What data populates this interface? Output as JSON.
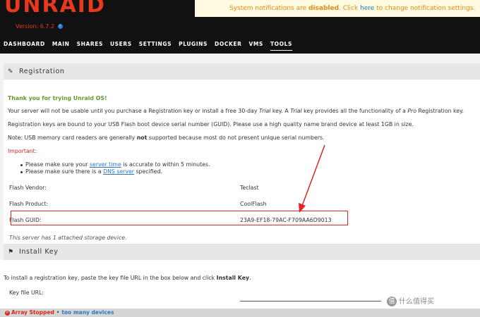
{
  "header": {
    "logo_text": "UNRAID",
    "version": "Version: 6.7.2",
    "info_icon": "info-icon",
    "notification": {
      "prefix": "System notifications are ",
      "state": "disabled",
      "middle": ". Click ",
      "link": "here",
      "suffix": " to change notification settings."
    }
  },
  "nav": {
    "items": [
      "DASHBOARD",
      "MAIN",
      "SHARES",
      "USERS",
      "SETTINGS",
      "PLUGINS",
      "DOCKER",
      "VMS",
      "TOOLS"
    ],
    "active": "TOOLS"
  },
  "registration": {
    "title": "Registration",
    "icon": "pencil-icon",
    "thanks": "Thank you for trying Unraid OS!",
    "line1_a": "Your server will not be usable until you purchase a Registration key or install a free 30-day ",
    "line1_trial": "Trial",
    "line1_b": " key. A ",
    "line1_trial2": "Trial",
    "line1_c": " key provides all the functionality of a ",
    "line1_pro": "Pro",
    "line1_d": " Registration key.",
    "line2": "Registration keys are bound to your USB Flash boot device serial number (GUID). Please use a high quality name brand device at least 1GB in size.",
    "line3_a": "Note: USB memory card readers are generally ",
    "line3_not": "not",
    "line3_b": " supported because most do not present unique serial numbers.",
    "important": "Important:",
    "bullet1_a": "Please make sure your ",
    "bullet1_link": "server time",
    "bullet1_b": " is accurate to within 5 minutes.",
    "bullet2_a": "Please make sure there is a ",
    "bullet2_link": "DNS server",
    "bullet2_b": " specified.",
    "fields": [
      {
        "label": "Flash Vendor:",
        "value": "Teclast"
      },
      {
        "label": "Flash Product:",
        "value": "CoolFlash"
      },
      {
        "label": "Flash GUID:",
        "value": "23A9-EF18-79AC-F709AA6D9013"
      }
    ],
    "storage_note": "This server has 1 attached storage device."
  },
  "install_key": {
    "title": "Install Key",
    "icon": "flag-icon",
    "instr_a": "To install a registration key, paste the key file URL in the box below and click ",
    "instr_bold": "Install Key",
    "instr_b": ".",
    "keyfile_label": "Key file URL:"
  },
  "footer": {
    "status": "Array Stopped",
    "separator": "•",
    "devices": "too many devices"
  },
  "watermark": {
    "badge": "值",
    "text": "什么值得买"
  },
  "colors": {
    "header_bg": "#111111",
    "accent": "#e8391e",
    "annotation_red": "#e02424",
    "link": "#2b78c2",
    "thanks_green": "#5e9c28"
  }
}
